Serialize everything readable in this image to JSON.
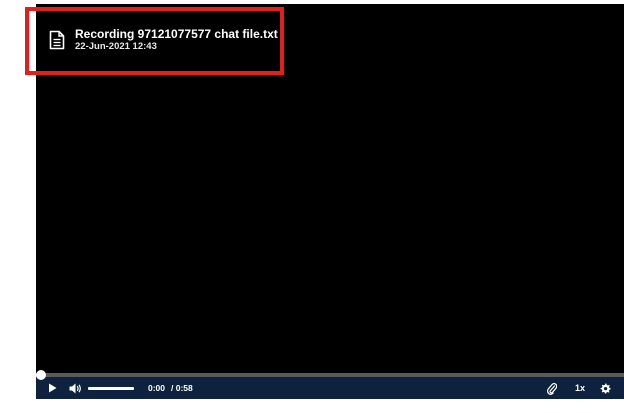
{
  "file": {
    "name": "Recording 97121077577 chat file.txt",
    "date": "22-Jun-2021 12:43",
    "icon": "document-icon"
  },
  "player": {
    "progress": 0,
    "time_current": "0:00",
    "time_total": "/ 0:58",
    "speed": "1x",
    "icons": {
      "play": "play-icon",
      "volume": "volume-icon",
      "attachment": "paperclip-icon",
      "settings": "gear-icon"
    }
  },
  "colors": {
    "highlight": "#e0201e",
    "control_bar": "#0e2240",
    "stage": "#000000"
  }
}
